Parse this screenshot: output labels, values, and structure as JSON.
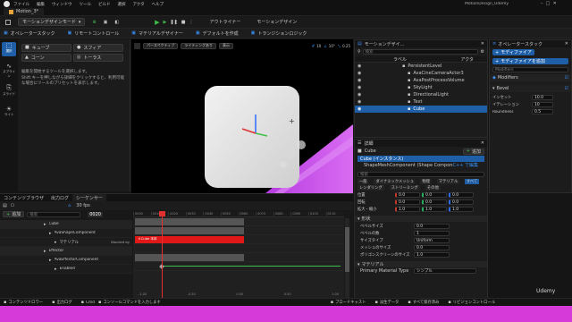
{
  "menubar": {
    "items": [
      "ファイル",
      "編集",
      "ウィンドウ",
      "ツール",
      "ビルド",
      "選択",
      "アクタ",
      "ヘルプ"
    ],
    "project_name": "MotionDesign_Udemy"
  },
  "level_tab": {
    "label": "Motion_3*"
  },
  "toolbar": {
    "mode_label": "モーションデザインモード",
    "action_labels": [
      "アウトライナー",
      "モーションデザイン"
    ]
  },
  "mode_bar": {
    "items": [
      "オペレータースタック",
      "リモートコントロール",
      "マテリアルデザイナー",
      "デフォルトを作成",
      "トランジションロジック"
    ]
  },
  "tools_panel": {
    "categories": [
      "選択",
      "スプライン",
      "スライド",
      "ライト"
    ],
    "tools": [
      "キューブ",
      "スフィア",
      "コーン",
      "トーラス"
    ],
    "help_text": "編集を開始するツールを選択します。",
    "help_text2": "Shift キーを押しながら詳細をクリックすると、利用可能な場合にツールのプリセットを表示します。"
  },
  "viewport": {
    "perspective_label": "パースペクティブ",
    "lit_label": "ライティングあり",
    "show_label": "表示",
    "grid_value": "10",
    "angle_value": "10°",
    "scale_value": "0.25"
  },
  "outliner": {
    "title": "モーションデザイ...",
    "search_placeholder": "検索",
    "col_label": "ラベル",
    "col_type": "アクタ",
    "items": [
      {
        "label": "PersistentLevel",
        "indent": 0
      },
      {
        "label": "AvaCineCameraActor3",
        "indent": 1
      },
      {
        "label": "AvaPostProcessVolume",
        "indent": 1
      },
      {
        "label": "SkyLight",
        "indent": 1
      },
      {
        "label": "DirectionalLight",
        "indent": 1
      },
      {
        "label": "Text",
        "indent": 1
      },
      {
        "label": "Cube",
        "indent": 1
      }
    ],
    "selected_index": 6
  },
  "operator_stack": {
    "title": "オペレータースタック",
    "add_button": "モディファイア",
    "add_button2": "モディファイアを追加",
    "search_placeholder": "Modifiers",
    "modifiers_label": "Modifiers",
    "bevel": {
      "name": "Bevel",
      "props": [
        {
          "label": "インセット",
          "value": "10.0"
        },
        {
          "label": "イテレーション",
          "value": "10"
        },
        {
          "label": "Roundness",
          "value": "0.5"
        }
      ]
    }
  },
  "details": {
    "title": "詳細",
    "actor_name": "Cube",
    "add_button": "追加",
    "component_root": "Cube (インスタンス)",
    "component_child": "ShapeMeshComponent (Shape Component)",
    "edit_cpp": "C++ で編集",
    "search_placeholder": "検索",
    "filter_tabs": [
      "一般",
      "ダイナミックメッシュ",
      "物理",
      "マテリアル",
      "すべて"
    ],
    "filter_tabs2": [
      "レンダリング",
      "ストリーミング",
      "その他"
    ],
    "transform_rows": [
      {
        "label": "位置",
        "values": [
          "0.0",
          "0.0",
          "0.0"
        ]
      },
      {
        "label": "回転",
        "values": [
          "0.0",
          "0.0",
          "0.0"
        ]
      },
      {
        "label": "拡大・縮小",
        "values": [
          "1.0",
          "1.0",
          "1.0"
        ]
      }
    ],
    "shape_section": "形状",
    "shape_rows": [
      {
        "label": "ベベルサイズ",
        "value": "0.0"
      },
      {
        "label": "ベベルの数",
        "value": "1"
      },
      {
        "label": "サイズタイプ",
        "value": "Uniform"
      },
      {
        "label": "メッシュのサイズ",
        "value": "0.0"
      },
      {
        "label": "ポリゴンスクリーンのサイズ",
        "value": "1.0"
      }
    ],
    "material_section": "マテリアル",
    "material_row": {
      "label": "Primary Material Type",
      "value": "シンプル"
    }
  },
  "sequencer": {
    "tabs": [
      "コンテンツブラウザ",
      "出力ログ",
      "シーケンサー"
    ],
    "fps": "30 fps",
    "frame": "0020",
    "add_label": "追加",
    "search_placeholder": "検索",
    "tracks": [
      {
        "label": "Cube",
        "indent": 1
      },
      {
        "label": "AvaShapeComponent",
        "indent": 2
      },
      {
        "label": "マテリアル",
        "indent": 3
      },
      {
        "label": "Effector",
        "indent": 1
      },
      {
        "label": "AvaEffectorComponent",
        "indent": 2
      },
      {
        "label": "Enabled",
        "indent": 3
      }
    ],
    "material_key_label": "Ⅱ Cube 本体",
    "ruler": [
      "0000",
      "0010",
      "0020",
      "0030",
      "0040",
      "0050",
      "0060",
      "0070",
      "0080",
      "0090",
      "0100",
      "0110"
    ],
    "bottom_markers": [
      "-1.00",
      "-0.50",
      "0.00",
      "0.50",
      "1.00"
    ],
    "material_value": "Blocked by"
  },
  "statusbar": {
    "items": [
      "コンテンツドロワー",
      "出力ログ",
      "Cmd",
      "コンソールコマンドを入力します",
      "ブロードキャスト",
      "派生データ",
      "すべて保存済み",
      "リビジョンコントロール"
    ],
    "watermark": "Udemy"
  }
}
